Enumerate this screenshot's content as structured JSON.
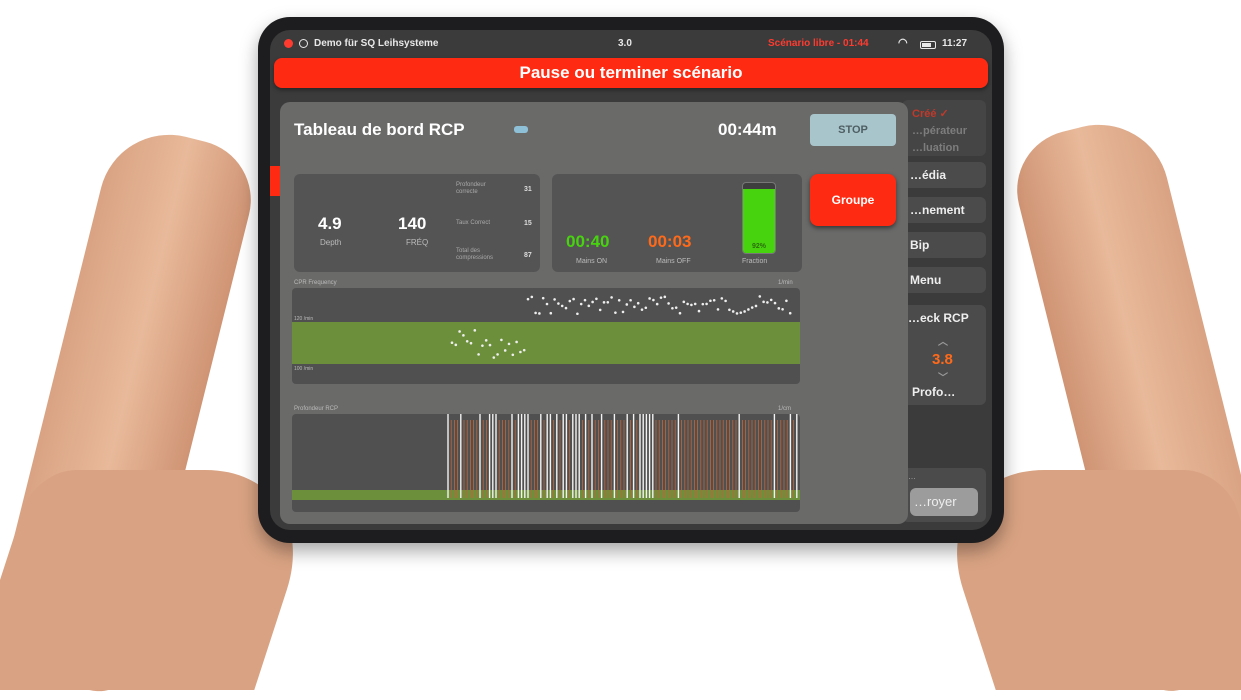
{
  "status_bar": {
    "app_name": "Demo für SQ Leihsysteme",
    "version": "3.0",
    "scenario": "Scénario libre - 01:44",
    "clock": "11:27"
  },
  "banner": {
    "label": "Pause ou terminer scénario"
  },
  "sidebar": {
    "top_partial": [
      "Créé ✓",
      "…pérateur",
      "…luation"
    ],
    "items": [
      "…édia",
      "…nement",
      "Bip",
      "Menu"
    ],
    "feedback_title": "…eck RCP",
    "feedback_value": "3.8",
    "feedback_sub": "Profo…",
    "send_switch_label": "…",
    "send_label": "…royer"
  },
  "dashboard": {
    "title": "Tableau de bord RCP",
    "timer": "00:44m",
    "stop_label": "STOP",
    "groupe_label": "Groupe",
    "depth_value": "4.9",
    "depth_label": "Depth",
    "freq_value": "140",
    "freq_label": "FRÉQ",
    "stats": [
      {
        "label": "Profondeur correcte",
        "value": "31"
      },
      {
        "label": "Taux Correct",
        "value": "15"
      },
      {
        "label": "Total des compressions",
        "value": "87"
      }
    ],
    "hands_on_value": "00:40",
    "hands_on_label": "Mains ON",
    "hands_off_value": "00:03",
    "hands_off_label": "Mains OFF",
    "fraction_label": "Fraction",
    "fraction_value": "92%",
    "fraction_pct": 0.92,
    "freq_chart_title": "CPR Frequency",
    "freq_chart_unit": "1/min",
    "freq_tick_high": "120 /min",
    "freq_tick_low": "100 /min",
    "depth_chart_title": "Profondeur RCP",
    "depth_chart_unit": "1/cm"
  },
  "colors": {
    "accent_red": "#ff2a12",
    "good_green": "#47d40f",
    "warn_orange": "#ff6a1a",
    "band_green": "#6c8f3b"
  }
}
